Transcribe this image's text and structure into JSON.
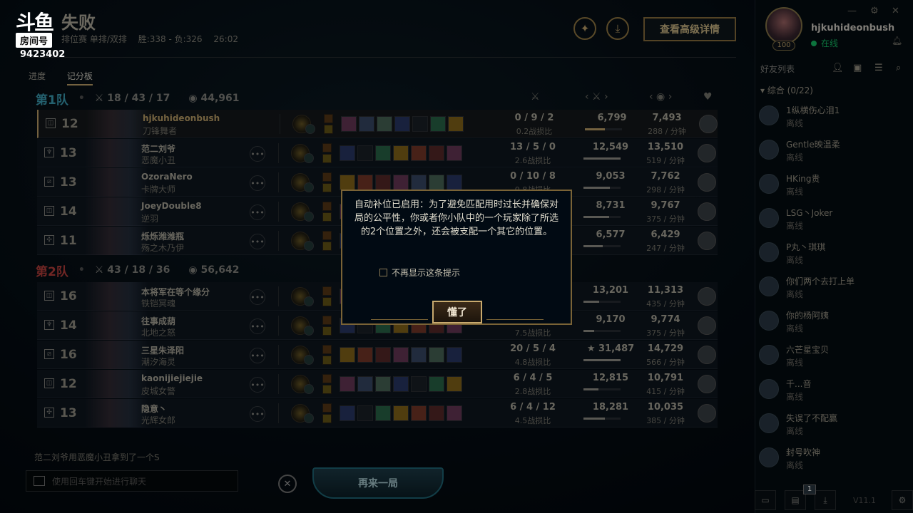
{
  "brand": {
    "name": "斗鱼",
    "room_label": "房间号",
    "room_number": "9423402"
  },
  "header": {
    "title": "失败",
    "mode": "排位赛 单排/双排",
    "record": "胜:338 - 负:326",
    "duration": "26:02",
    "tabs": [
      "进度",
      "记分板"
    ],
    "active_tab": "记分板",
    "detail_button": "查看高级详情"
  },
  "columns": {
    "kda_icon": "swords-icon",
    "damage_icon": "sword-icon",
    "gold_icon": "coins-icon",
    "honor_icon": "heart-icon"
  },
  "team1": {
    "name": "第1队",
    "kda": "18 / 43 / 17",
    "gold": "44,961",
    "players": [
      {
        "level": "12",
        "position": "top-icon",
        "summoner": "hjkuhideonbush",
        "champion": "刀锋舞者",
        "kda": "0 / 9 / 2",
        "ratio": "0.2战损比",
        "damage": "6,799",
        "damage_pct": 0.54,
        "gold": "7,493",
        "gold_per_min": "288 / 分钟",
        "me": true
      },
      {
        "level": "13",
        "position": "jungle-icon",
        "summoner": "范二刘爷",
        "champion": "恶魔小丑",
        "kda": "13 / 5 / 0",
        "ratio": "2.6战损比",
        "damage": "12,549",
        "damage_pct": 1.0,
        "gold": "13,510",
        "gold_per_min": "519 / 分钟",
        "me": false
      },
      {
        "level": "13",
        "position": "mid-icon",
        "summoner": "OzoraNero",
        "champion": "卡牌大师",
        "kda": "0 / 10 / 8",
        "ratio": "0.8战损比",
        "damage": "9,053",
        "damage_pct": 0.72,
        "gold": "7,762",
        "gold_per_min": "298 / 分钟",
        "me": false
      },
      {
        "level": "14",
        "position": "bot-icon",
        "summoner": "JoeyDouble8",
        "champion": "逆羽",
        "kda": "",
        "ratio": "",
        "damage": "8,731",
        "damage_pct": 0.7,
        "gold": "9,767",
        "gold_per_min": "375 / 分钟",
        "me": false
      },
      {
        "level": "11",
        "position": "support-icon",
        "summoner": "烁烁潍潍瓶",
        "champion": "殇之木乃伊",
        "kda": "",
        "ratio": "",
        "damage": "6,577",
        "damage_pct": 0.52,
        "gold": "6,429",
        "gold_per_min": "247 / 分钟",
        "me": false
      }
    ]
  },
  "team2": {
    "name": "第2队",
    "kda": "43 / 18 / 36",
    "gold": "56,642",
    "players": [
      {
        "level": "16",
        "position": "top-icon",
        "summoner": "本将军在等个缘分",
        "champion": "铁铠冥魂",
        "kda": "",
        "ratio": "",
        "damage": "13,201",
        "damage_pct": 0.42,
        "gold": "11,313",
        "gold_per_min": "435 / 分钟",
        "me": false
      },
      {
        "level": "14",
        "position": "jungle-icon",
        "summoner": "往事成葫",
        "champion": "北地之怒",
        "kda": "",
        "ratio": "7.5战损比",
        "damage": "9,170",
        "damage_pct": 0.29,
        "gold": "9,774",
        "gold_per_min": "375 / 分钟",
        "me": false
      },
      {
        "level": "16",
        "position": "mid-icon",
        "summoner": "三星朱泽阳",
        "champion": "潮汐海灵",
        "kda": "20 / 5 / 4",
        "ratio": "4.8战损比",
        "damage": "★ 31,487",
        "damage_pct": 1.0,
        "gold": "14,729",
        "gold_per_min": "566 / 分钟",
        "me": false
      },
      {
        "level": "12",
        "position": "bot-icon",
        "summoner": "kaonijiejiejie",
        "champion": "皮城女警",
        "kda": "6 / 4 / 5",
        "ratio": "2.8战损比",
        "damage": "12,815",
        "damage_pct": 0.41,
        "gold": "10,791",
        "gold_per_min": "415 / 分钟",
        "me": false
      },
      {
        "level": "13",
        "position": "support-icon",
        "summoner": "隐意丶",
        "champion": "光辉女郎",
        "kda": "6 / 4 / 12",
        "ratio": "4.5战损比",
        "damage": "18,281",
        "damage_pct": 0.58,
        "gold": "10,035",
        "gold_per_min": "385 / 分钟",
        "me": false
      }
    ]
  },
  "footer": {
    "message": "范二刘爷用恶魔小丑拿到了一个S",
    "chat_placeholder": "使用回车键开始进行聊天",
    "play_again": "再来一局"
  },
  "modal": {
    "text": "自动补位已启用：为了避免匹配用时过长并确保对局的公平性，你或者你小队中的一个玩家除了所选的2个位置之外，还会被支配一个其它的位置。",
    "checkbox": "不再显示这条提示",
    "ok": "懂了"
  },
  "social": {
    "name": "hjkuhideonbush",
    "level": "100",
    "status": "在线",
    "friends_title": "好友列表",
    "group": "综合 (0/22)",
    "friends": [
      {
        "name": "1纵横伤心泪1",
        "status": "离线"
      },
      {
        "name": "Gentle映温柔",
        "status": "离线"
      },
      {
        "name": "HKing贵",
        "status": "离线"
      },
      {
        "name": "LSG丶Joker",
        "status": "离线"
      },
      {
        "name": "P丸丶琪琪",
        "status": "离线"
      },
      {
        "name": "你们两个去打上单",
        "status": "离线"
      },
      {
        "name": "你的杨阿姨",
        "status": "离线"
      },
      {
        "name": "六芒星宝贝",
        "status": "离线"
      },
      {
        "name": "千...音",
        "status": "离线"
      },
      {
        "name": "失误了不配赢",
        "status": "离线"
      },
      {
        "name": "封号吹神",
        "status": "离线"
      }
    ],
    "badge": "1",
    "version": "V11.1"
  },
  "colors": {
    "gold": "#c8aa6e",
    "team1": "#3fa7c0",
    "team2": "#c1423f",
    "online": "#15c76a"
  }
}
